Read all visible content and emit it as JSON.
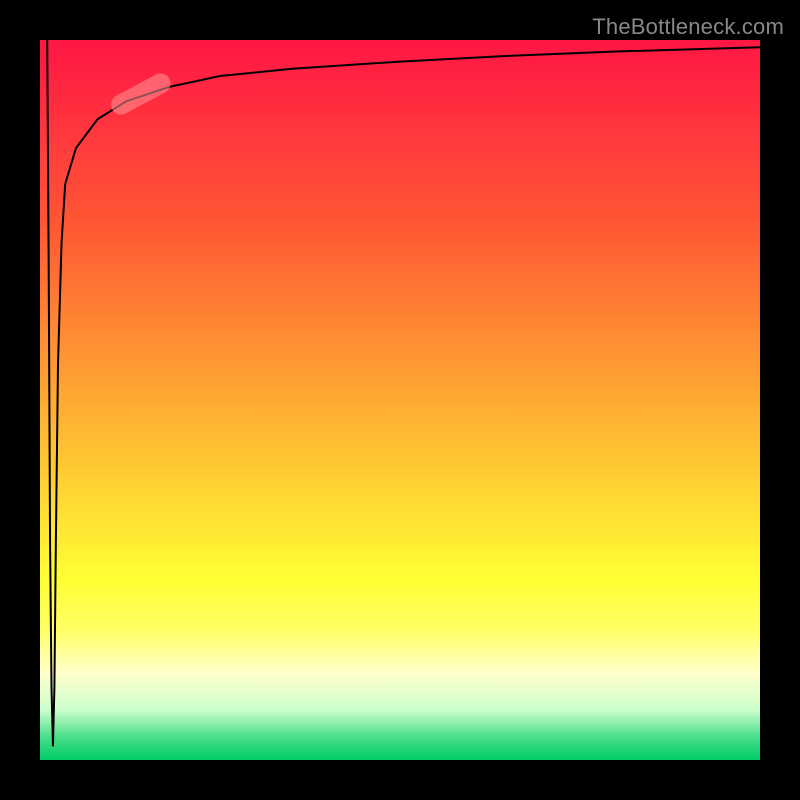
{
  "watermark": "TheBottleneck.com",
  "chart_data": {
    "type": "line",
    "title": "",
    "xlabel": "",
    "ylabel": "",
    "xlim": [
      0,
      100
    ],
    "ylim": [
      0,
      100
    ],
    "grid": false,
    "legend": false,
    "background_gradient": {
      "top": "#ff1744",
      "mid1": "#ff9933",
      "mid2": "#ffff33",
      "bottom": "#00cc66"
    },
    "series": [
      {
        "name": "left-spike",
        "x": [
          1.0,
          1.2,
          1.3,
          1.4,
          1.6,
          1.8,
          2.0,
          2.2,
          2.5,
          3.0,
          3.5
        ],
        "values": [
          100,
          70,
          50,
          30,
          10,
          2,
          10,
          30,
          55,
          72,
          80
        ]
      },
      {
        "name": "main-curve",
        "x": [
          3.5,
          5,
          8,
          12,
          18,
          25,
          35,
          50,
          65,
          80,
          100
        ],
        "values": [
          80,
          85,
          89,
          91.5,
          93.5,
          95,
          96,
          97,
          97.8,
          98.4,
          99
        ]
      }
    ],
    "highlight_marker": {
      "x_center": 14,
      "y_center": 92.5,
      "length": 9,
      "angle_deg": 28,
      "color": "rgba(255,150,150,0.55)"
    }
  }
}
